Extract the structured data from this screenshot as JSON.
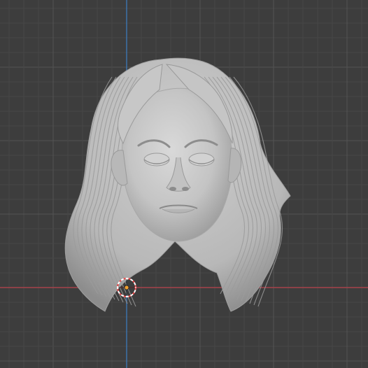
{
  "app": "3D viewport",
  "viewport": {
    "background": "#3d3d3d",
    "grid_minor_color": "#464646",
    "grid_major_color": "#545454",
    "axis_x_color": "#a6434b",
    "axis_y_color": "#3d7ec4"
  },
  "object": {
    "type": "sculpt",
    "description_icon": "head-mesh",
    "material_color": "#c9c9c9",
    "shadow_color": "#8e8e8e"
  },
  "gizmos": {
    "object_origin_icon": "origin-dot-icon",
    "cursor_icon": "3d-cursor-icon"
  }
}
